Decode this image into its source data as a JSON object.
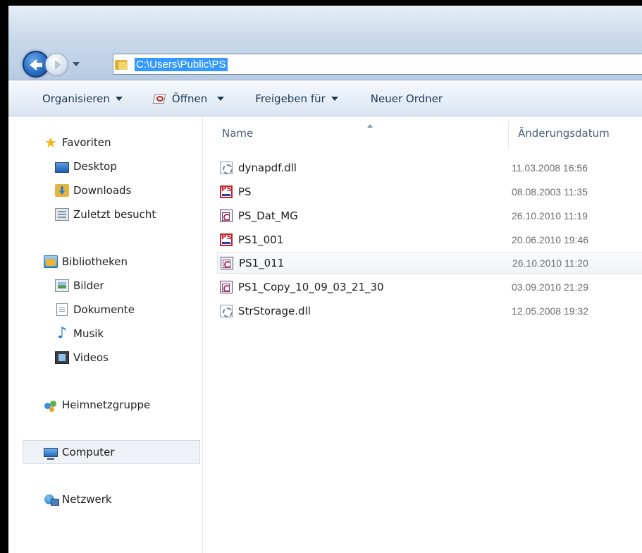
{
  "address": {
    "path": "C:\\Users\\Public\\PS"
  },
  "commandbar": {
    "organize": "Organisieren",
    "open": "Öffnen",
    "share": "Freigeben für",
    "new_folder": "Neuer Ordner"
  },
  "sidebar": {
    "favorites": "Favoriten",
    "desktop": "Desktop",
    "downloads": "Downloads",
    "recent": "Zuletzt besucht",
    "libraries": "Bibliotheken",
    "pictures": "Bilder",
    "documents": "Dokumente",
    "music": "Musik",
    "videos": "Videos",
    "homegroup": "Heimnetzgruppe",
    "computer": "Computer",
    "network": "Netzwerk"
  },
  "columns": {
    "name": "Name",
    "modified": "Änderungsdatum"
  },
  "files": [
    {
      "name": "dynapdf.dll",
      "date": "11.03.2008 16:56",
      "icon": "dll-file-icon"
    },
    {
      "name": "PS",
      "date": "08.08.2003 11:35",
      "icon": "ps-app-icon"
    },
    {
      "name": "PS_Dat_MG",
      "date": "26.10.2010 11:19",
      "icon": "ps-document-icon"
    },
    {
      "name": "PS1_001",
      "date": "20.06.2010 19:46",
      "icon": "ps-app-icon"
    },
    {
      "name": "PS1_011",
      "date": "26.10.2010 11:20",
      "icon": "ps-document-icon"
    },
    {
      "name": "PS1_Copy_10_09_03_21_30",
      "date": "03.09.2010 21:29",
      "icon": "ps-document-icon"
    },
    {
      "name": "StrStorage.dll",
      "date": "12.05.2008 19:32",
      "icon": "dll-file-icon"
    }
  ],
  "colors": {
    "selection": "#3399ff",
    "toolbar_text": "#1e3954",
    "date_text": "#6d6d6d"
  }
}
